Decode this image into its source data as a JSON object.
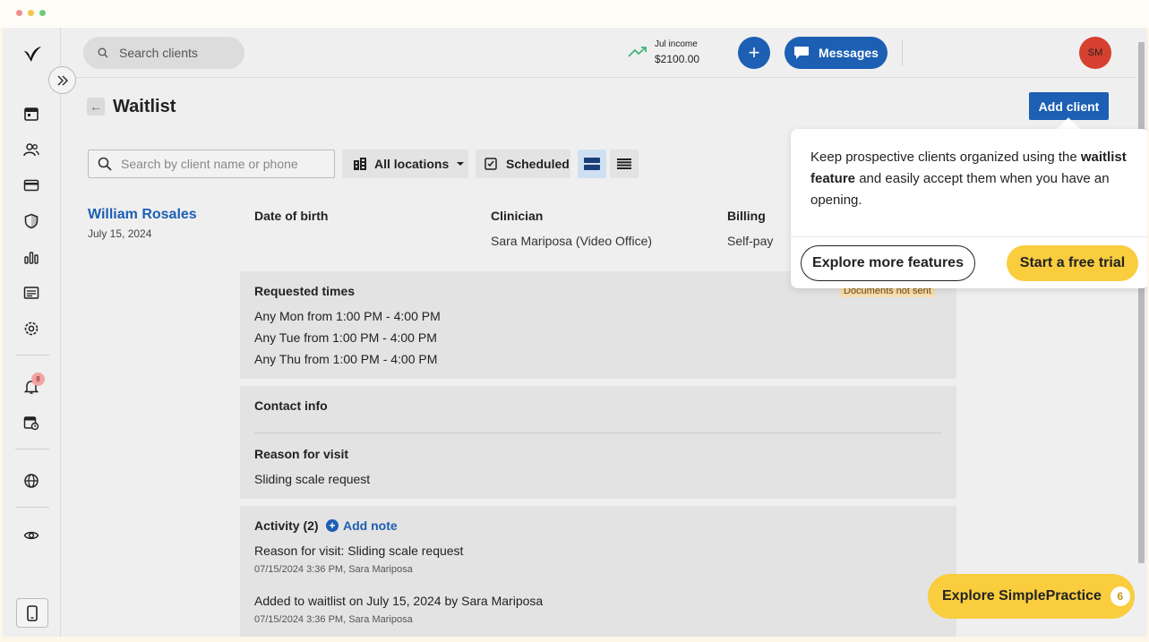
{
  "header": {
    "search_placeholder": "Search clients",
    "income_label": "Jul income",
    "income_amount": "$2100.00",
    "messages_label": "Messages",
    "avatar_initials": "SM"
  },
  "sidebar": {
    "notification_count": "8",
    "items": [
      "calendar-icon",
      "clients-icon",
      "billing-icon",
      "insurance-icon",
      "analytics-icon",
      "activity-icon",
      "settings-icon",
      "notifications-icon",
      "requests-icon",
      "globe-icon",
      "eye-icon"
    ]
  },
  "page": {
    "title": "Waitlist",
    "add_client_label": "Add client"
  },
  "filters": {
    "search_placeholder": "Search by client name or phone",
    "location_label": "All locations",
    "scheduled_label": "Scheduled"
  },
  "client": {
    "name": "William Rosales",
    "date": "July 15, 2024",
    "dob_label": "Date of birth",
    "dob_value": "",
    "clinician_label": "Clinician",
    "clinician_value": "Sara Mariposa (Video Office)",
    "billing_label": "Billing",
    "billing_value": "Self-pay",
    "docs_status": "Documents not sent"
  },
  "requested_times": {
    "title": "Requested times",
    "items": [
      "Any Mon from 1:00 PM - 4:00 PM",
      "Any Tue from 1:00 PM - 4:00 PM",
      "Any Thu from 1:00 PM - 4:00 PM"
    ]
  },
  "contact": {
    "title": "Contact info",
    "reason_title": "Reason for visit",
    "reason_value": "Sliding scale request"
  },
  "activity": {
    "title": "Activity (2)",
    "add_note_label": "Add note",
    "items": [
      {
        "text": "Reason for visit: Sliding scale request",
        "meta": "07/15/2024 3:36 PM, Sara Mariposa"
      },
      {
        "text": "Added to waitlist on July 15, 2024 by Sara Mariposa",
        "meta": "07/15/2024 3:36 PM, Sara Mariposa"
      }
    ]
  },
  "popover": {
    "text_before": "Keep prospective clients organized using the ",
    "text_bold": "waitlist feature",
    "text_after": " and easily accept them when you have an opening.",
    "explore_label": "Explore more features",
    "trial_label": "Start a free trial"
  },
  "explore_sp": {
    "label": "Explore SimplePractice",
    "count": "6"
  },
  "colors": {
    "primary": "#1c5fb3",
    "yellow": "#f9cd3e",
    "avatar": "#d6402f",
    "income_trend": "#3fb57a"
  }
}
